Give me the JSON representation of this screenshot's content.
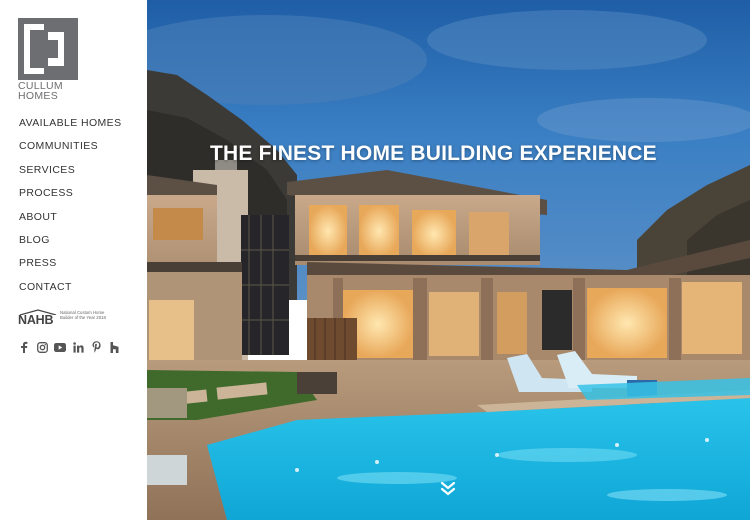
{
  "brand": {
    "line1": "CULLUM",
    "line2": "HOMES"
  },
  "nav": {
    "items": [
      {
        "label": "AVAILABLE HOMES"
      },
      {
        "label": "COMMUNITIES"
      },
      {
        "label": "SERVICES"
      },
      {
        "label": "PROCESS"
      },
      {
        "label": "ABOUT"
      },
      {
        "label": "BLOG"
      },
      {
        "label": "PRESS"
      },
      {
        "label": "CONTACT"
      }
    ]
  },
  "award": {
    "org": "NAHB",
    "text": "National Custom Home Builder of the Year 2018"
  },
  "social": [
    "facebook-icon",
    "instagram-icon",
    "youtube-icon",
    "linkedin-icon",
    "pinterest-icon",
    "houzz-icon"
  ],
  "hero": {
    "headline": "THE FINEST HOME BUILDING EXPERIENCE"
  },
  "colors": {
    "logo_gray": "#6d6e71",
    "nav_text": "#333333",
    "sky": "#2f6fb0",
    "pool": "#2fc6e8"
  }
}
